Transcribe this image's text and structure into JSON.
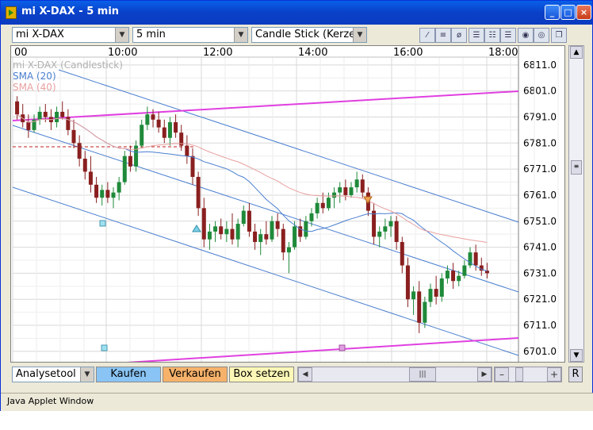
{
  "window": {
    "title": "mi X-DAX - 5 min"
  },
  "toolbar": {
    "instrument": "mi X-DAX",
    "interval": "5 min",
    "chart_type": "Candle Stick (Kerze"
  },
  "legend": {
    "instrument": "mi X-DAX (Candlestick)",
    "sma20": "SMA (20)",
    "sma40": "SMA (40)"
  },
  "bottom": {
    "analysetool": "Analysetool",
    "kaufen": "Kaufen",
    "verkaufen": "Verkaufen",
    "box_setzen": "Box setzen",
    "zoom_minus": "–",
    "zoom_plus": "+",
    "reset": "R"
  },
  "status": {
    "text": "Java Applet Window"
  },
  "colors": {
    "up": "#1f8a3a",
    "down": "#8a1f1f",
    "sma20": "#4a7fd0",
    "sma40": "#e8a0a0",
    "channel": "#4a7fd0",
    "magenta": "#e040e0"
  },
  "chart_data": {
    "type": "candlestick",
    "xlabels": [
      "00",
      "10:00",
      "12:00",
      "14:00",
      "16:00",
      "18:00"
    ],
    "yticks": [
      "6811.0",
      "6801.0",
      "6791.0",
      "6781.0",
      "6771.0",
      "6761.0",
      "6751.0",
      "6741.0",
      "6731.0",
      "6721.0",
      "6711.0",
      "6701.0"
    ],
    "ylim": [
      6697,
      6814
    ],
    "candles": [
      [
        6797,
        6799,
        6790,
        6792
      ],
      [
        6792,
        6796,
        6787,
        6789
      ],
      [
        6789,
        6792,
        6783,
        6786
      ],
      [
        6786,
        6792,
        6785,
        6790
      ],
      [
        6790,
        6795,
        6788,
        6793
      ],
      [
        6793,
        6796,
        6789,
        6791
      ],
      [
        6791,
        6794,
        6786,
        6789
      ],
      [
        6789,
        6795,
        6787,
        6793
      ],
      [
        6793,
        6797,
        6790,
        6791
      ],
      [
        6791,
        6794,
        6784,
        6786
      ],
      [
        6786,
        6790,
        6779,
        6781
      ],
      [
        6781,
        6784,
        6772,
        6775
      ],
      [
        6775,
        6778,
        6767,
        6770
      ],
      [
        6770,
        6776,
        6762,
        6765
      ],
      [
        6765,
        6768,
        6758,
        6760
      ],
      [
        6760,
        6765,
        6757,
        6763
      ],
      [
        6763,
        6766,
        6758,
        6760
      ],
      [
        6760,
        6764,
        6756,
        6762
      ],
      [
        6762,
        6768,
        6759,
        6766
      ],
      [
        6766,
        6778,
        6765,
        6776
      ],
      [
        6776,
        6780,
        6770,
        6772
      ],
      [
        6772,
        6782,
        6770,
        6780
      ],
      [
        6780,
        6790,
        6779,
        6788
      ],
      [
        6788,
        6795,
        6786,
        6792
      ],
      [
        6792,
        6794,
        6787,
        6790
      ],
      [
        6790,
        6793,
        6785,
        6787
      ],
      [
        6787,
        6790,
        6781,
        6783
      ],
      [
        6783,
        6791,
        6780,
        6789
      ],
      [
        6789,
        6792,
        6783,
        6785
      ],
      [
        6785,
        6788,
        6778,
        6780
      ],
      [
        6780,
        6784,
        6773,
        6776
      ],
      [
        6776,
        6779,
        6765,
        6768
      ],
      [
        6768,
        6770,
        6753,
        6756
      ],
      [
        6756,
        6760,
        6741,
        6744
      ],
      [
        6744,
        6750,
        6740,
        6747
      ],
      [
        6747,
        6751,
        6743,
        6749
      ],
      [
        6749,
        6752,
        6744,
        6746
      ],
      [
        6746,
        6751,
        6743,
        6748
      ],
      [
        6748,
        6754,
        6742,
        6744
      ],
      [
        6744,
        6752,
        6741,
        6750
      ],
      [
        6750,
        6757,
        6749,
        6755
      ],
      [
        6755,
        6758,
        6745,
        6747
      ],
      [
        6747,
        6750,
        6740,
        6743
      ],
      [
        6743,
        6748,
        6738,
        6746
      ],
      [
        6746,
        6751,
        6742,
        6744
      ],
      [
        6744,
        6753,
        6743,
        6751
      ],
      [
        6751,
        6754,
        6745,
        6748
      ],
      [
        6748,
        6750,
        6736,
        6739
      ],
      [
        6739,
        6743,
        6731,
        6741
      ],
      [
        6741,
        6751,
        6740,
        6749
      ],
      [
        6749,
        6752,
        6743,
        6745
      ],
      [
        6745,
        6753,
        6744,
        6751
      ],
      [
        6751,
        6756,
        6749,
        6754
      ],
      [
        6754,
        6760,
        6752,
        6758
      ],
      [
        6758,
        6762,
        6754,
        6756
      ],
      [
        6756,
        6762,
        6755,
        6760
      ],
      [
        6760,
        6764,
        6756,
        6762
      ],
      [
        6762,
        6766,
        6758,
        6764
      ],
      [
        6764,
        6767,
        6759,
        6761
      ],
      [
        6761,
        6766,
        6760,
        6764
      ],
      [
        6764,
        6770,
        6762,
        6767
      ],
      [
        6767,
        6769,
        6760,
        6762
      ],
      [
        6762,
        6764,
        6753,
        6755
      ],
      [
        6755,
        6758,
        6742,
        6745
      ],
      [
        6745,
        6749,
        6741,
        6747
      ],
      [
        6747,
        6752,
        6744,
        6749
      ],
      [
        6749,
        6753,
        6745,
        6751
      ],
      [
        6751,
        6753,
        6740,
        6743
      ],
      [
        6743,
        6745,
        6731,
        6734
      ],
      [
        6734,
        6737,
        6718,
        6721
      ],
      [
        6721,
        6726,
        6715,
        6724
      ],
      [
        6724,
        6728,
        6708,
        6712
      ],
      [
        6712,
        6722,
        6710,
        6720
      ],
      [
        6720,
        6727,
        6718,
        6725
      ],
      [
        6725,
        6730,
        6719,
        6722
      ],
      [
        6722,
        6731,
        6720,
        6729
      ],
      [
        6729,
        6734,
        6727,
        6732
      ],
      [
        6732,
        6735,
        6725,
        6728
      ],
      [
        6728,
        6732,
        6726,
        6730
      ],
      [
        6730,
        6736,
        6729,
        6734
      ],
      [
        6734,
        6741,
        6733,
        6739
      ],
      [
        6739,
        6742,
        6732,
        6734
      ],
      [
        6734,
        6737,
        6730,
        6732
      ],
      [
        6732,
        6735,
        6729,
        6731
      ]
    ]
  }
}
